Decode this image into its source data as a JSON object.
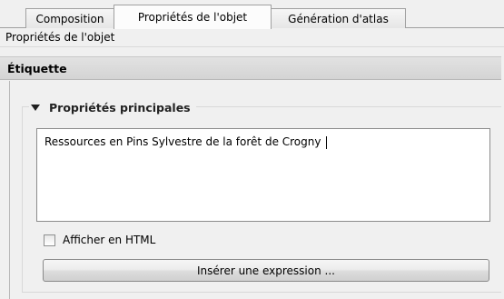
{
  "tabs": [
    {
      "label": "Composition",
      "active": false
    },
    {
      "label": "Propriétés de l'objet",
      "active": true
    },
    {
      "label": "Génération d'atlas",
      "active": false
    }
  ],
  "subheader": {
    "title": "Propriétés de l'objet"
  },
  "section": {
    "title": "Étiquette"
  },
  "group": {
    "title": "Propriétés principales"
  },
  "label_text": {
    "value": "Ressources en Pins Sylvestre de la forêt de Crogny "
  },
  "html_checkbox": {
    "label": "Afficher en HTML",
    "checked": false
  },
  "insert_button": {
    "label": "Insérer une expression ..."
  }
}
